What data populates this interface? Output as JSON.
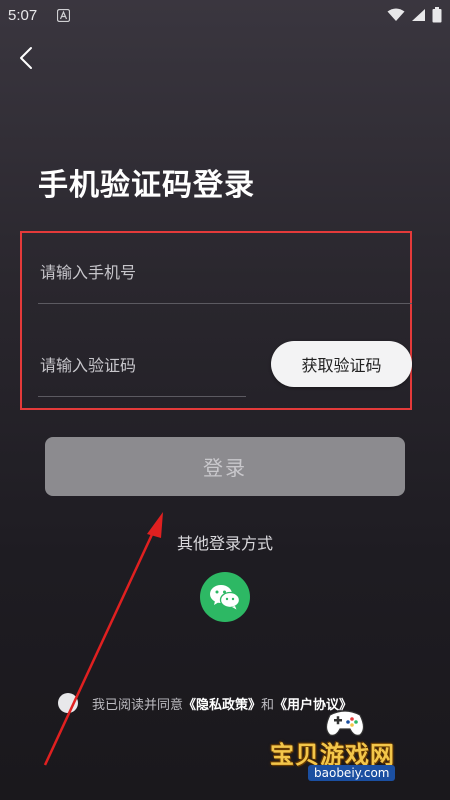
{
  "status_bar": {
    "time": "5:07",
    "icons": [
      "notification-a-icon",
      "wifi-icon",
      "signal-icon",
      "battery-icon"
    ]
  },
  "nav": {
    "back_icon": "chevron-left-icon"
  },
  "page": {
    "title": "手机验证码登录"
  },
  "form": {
    "phone_placeholder": "请输入手机号",
    "phone_value": "",
    "code_placeholder": "请输入验证码",
    "code_value": "",
    "get_code_label": "获取验证码",
    "highlight_color": "#e43a3a"
  },
  "login": {
    "label": "登录",
    "enabled": false
  },
  "alt_login": {
    "label": "其他登录方式",
    "wechat_icon": "wechat-icon",
    "wechat_color": "#2db864"
  },
  "agreement": {
    "prefix": "我已阅读并同意",
    "privacy_link": "《隐私政策》",
    "conjunction": "和",
    "terms_link": "《用户协议》",
    "checked": false
  },
  "watermark": {
    "title": "宝贝游戏网",
    "url": "baobeiy.com"
  }
}
